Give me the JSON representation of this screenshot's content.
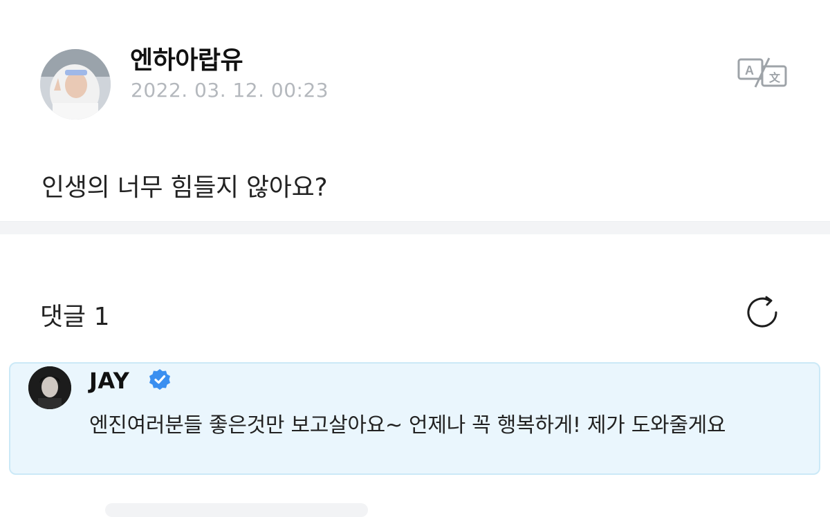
{
  "post": {
    "author_name": "엔하아랍유",
    "timestamp": "2022. 03. 12. 00:23",
    "body": "인생의 너무 힘들지 않아요?",
    "translate_icon": "translate-icon"
  },
  "comments": {
    "title": "댓글",
    "count": "1",
    "refresh_icon": "refresh-icon",
    "items": [
      {
        "author": "JAY",
        "verified": true,
        "text": "엔진여러분들 좋은것만 보고살아요~ 언제나 꼭 행복하게! 제가 도와줄게요"
      }
    ]
  },
  "colors": {
    "muted_text": "#b4b8bd",
    "comment_bg": "#eaf6fd",
    "comment_border": "#cbe9f7",
    "verified_badge": "#3a8ff0"
  }
}
